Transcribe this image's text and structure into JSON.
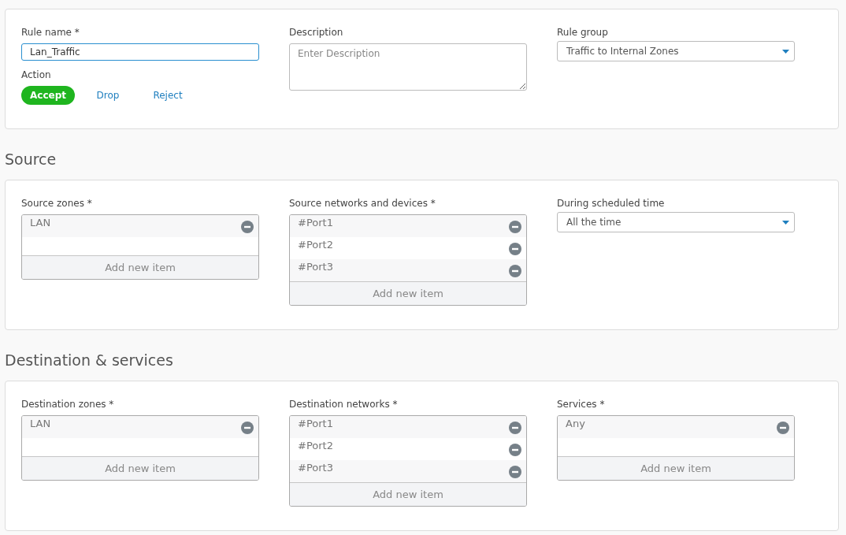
{
  "general": {
    "rule_name": {
      "label": "Rule name *",
      "value": "Lan_Traffic",
      "focused": true
    },
    "description": {
      "label": "Description",
      "placeholder": "Enter Description"
    },
    "rule_group": {
      "label": "Rule group",
      "value": "Traffic to Internal Zones"
    },
    "action": {
      "label": "Action",
      "options": [
        {
          "label": "Accept",
          "selected": true
        },
        {
          "label": "Drop",
          "selected": false
        },
        {
          "label": "Reject",
          "selected": false
        }
      ]
    }
  },
  "sections": [
    {
      "title": "Source",
      "fields": [
        {
          "kind": "list",
          "label": "Source zones *",
          "items": [
            "LAN"
          ],
          "add_label": "Add new item"
        },
        {
          "kind": "list",
          "label": "Source networks and devices *",
          "items": [
            "#Port1",
            "#Port2",
            "#Port3"
          ],
          "add_label": "Add new item"
        },
        {
          "kind": "select",
          "label": "During scheduled time",
          "value": "All the time"
        }
      ]
    },
    {
      "title": "Destination & services",
      "fields": [
        {
          "kind": "list",
          "label": "Destination zones *",
          "items": [
            "LAN"
          ],
          "add_label": "Add new item"
        },
        {
          "kind": "list",
          "label": "Destination networks *",
          "items": [
            "#Port1",
            "#Port2",
            "#Port3"
          ],
          "add_label": "Add new item"
        },
        {
          "kind": "list",
          "label": "Services *",
          "items": [
            "Any"
          ],
          "add_label": "Add new item"
        }
      ]
    }
  ]
}
